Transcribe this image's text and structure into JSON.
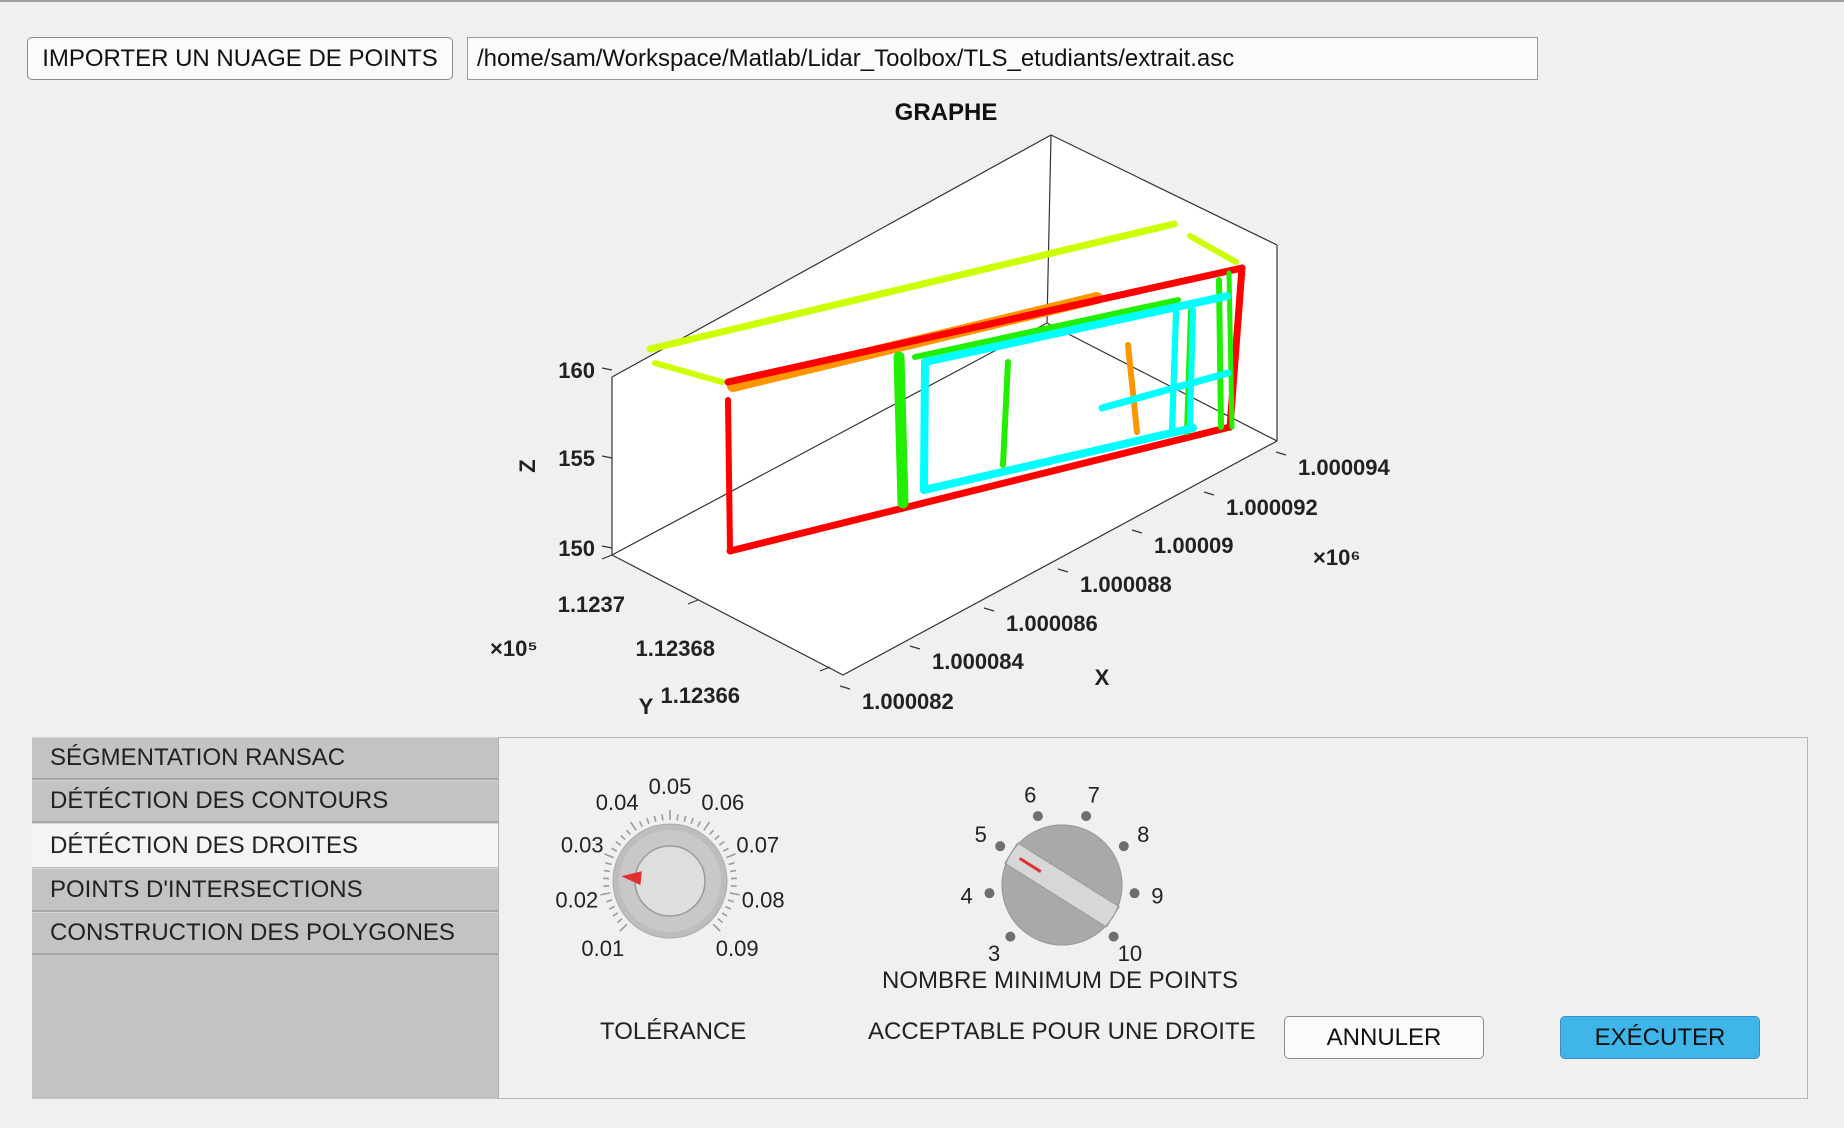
{
  "toolbar": {
    "import_label": "IMPORTER UN NUAGE DE POINTS",
    "file_path": "/home/sam/Workspace/Matlab/Lidar_Toolbox/TLS_etudiants/extrait.asc"
  },
  "plot": {
    "title": "GRAPHE",
    "xlabel": "X",
    "ylabel": "Y",
    "zlabel": "Z",
    "x_exponent": "×10⁶",
    "y_exponent": "×10⁵",
    "x_ticks": [
      "1.000082",
      "1.000084",
      "1.000086",
      "1.000088",
      "1.00009",
      "1.000092",
      "1.000094"
    ],
    "y_ticks": [
      "1.12366",
      "1.12368",
      "1.1237"
    ],
    "z_ticks": [
      "150",
      "155",
      "160"
    ],
    "colors": {
      "red": "#ff0000",
      "orange": "#ff9500",
      "yellow_green": "#ccff00",
      "green": "#22ee00",
      "cyan": "#00ffff"
    }
  },
  "tabs": [
    {
      "label": "SÉGMENTATION RANSAC",
      "active": false
    },
    {
      "label": "DÉTÉCTION DES CONTOURS",
      "active": false
    },
    {
      "label": "DÉTÉCTION DES DROITES",
      "active": true
    },
    {
      "label": "POINTS D'INTERSECTIONS",
      "active": false
    },
    {
      "label": "CONSTRUCTION DES POLYGONES",
      "active": false
    }
  ],
  "tolerance": {
    "label": "TOLÉRANCE",
    "ticks": [
      "0.01",
      "0.02",
      "0.03",
      "0.04",
      "0.05",
      "0.06",
      "0.07",
      "0.08",
      "0.09"
    ],
    "value": 0.025
  },
  "min_points": {
    "label_line1": "NOMBRE MINIMUM DE POINTS",
    "label_line2": "ACCEPTABLE POUR UNE DROITE",
    "ticks": [
      "3",
      "4",
      "5",
      "6",
      "7",
      "8",
      "9",
      "10"
    ],
    "value": 5
  },
  "actions": {
    "cancel_label": "ANNULER",
    "run_label": "EXÉCUTER"
  }
}
